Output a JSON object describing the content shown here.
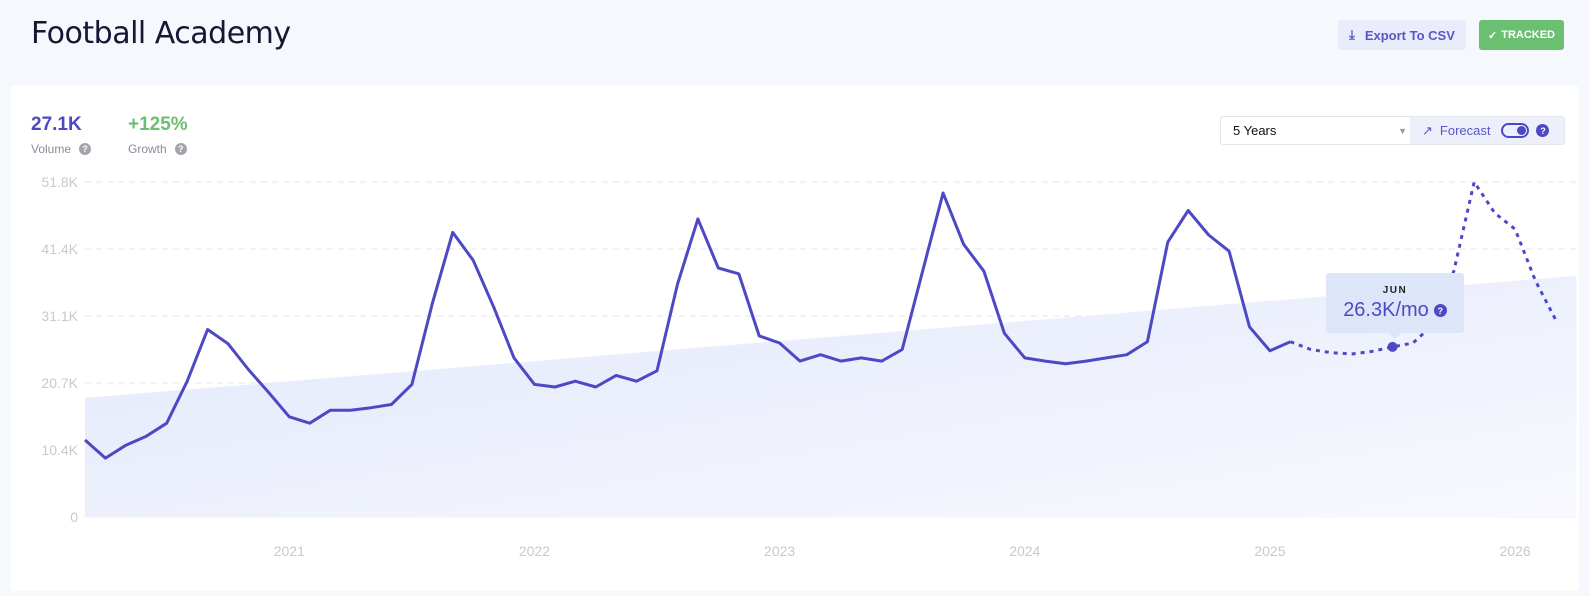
{
  "header": {
    "title": "Football Academy",
    "export_label": "Export To CSV",
    "tracked_label": "TRACKED",
    "check_glyph": "✓",
    "download_glyph": "⤓"
  },
  "stats": {
    "volume_value": "27.1K",
    "volume_label": "Volume",
    "growth_value": "+125%",
    "growth_label": "Growth",
    "help_glyph": "?"
  },
  "controls": {
    "range_selected": "5 Years",
    "caret_glyph": "▼",
    "forecast_label": "Forecast",
    "forecast_enabled": true,
    "trend_glyph": "↗"
  },
  "tooltip": {
    "month": "JUN",
    "value": "26.3K/mo"
  },
  "colors": {
    "accent": "#4d49c5",
    "growth": "#6bbf71",
    "trend_fill": "#e4e9fb"
  },
  "chart_data": {
    "type": "line",
    "title": "",
    "xlabel": "",
    "ylabel": "Volume",
    "ylim": [
      0,
      51800
    ],
    "y_ticks": [
      "0",
      "10.4K",
      "20.7K",
      "31.1K",
      "41.4K",
      "51.8K"
    ],
    "y_tick_values": [
      0,
      10360,
      20720,
      31080,
      41440,
      51800
    ],
    "x_ticks": [
      "2021",
      "2022",
      "2023",
      "2024",
      "2025",
      "2026"
    ],
    "x_tick_months": [
      10,
      22,
      34,
      46,
      58,
      70
    ],
    "grid": true,
    "series": [
      {
        "name": "Volume",
        "style": "solid",
        "start_month_index": 0,
        "values": [
          11900,
          9100,
          11100,
          12500,
          14500,
          21000,
          29000,
          26800,
          22800,
          19200,
          15500,
          14500,
          16500,
          16500,
          16900,
          17400,
          20500,
          33000,
          44000,
          39700,
          32500,
          24600,
          20500,
          20100,
          21000,
          20100,
          21900,
          21000,
          22600,
          36000,
          46100,
          38500,
          37600,
          28000,
          26900,
          24100,
          25100,
          24100,
          24600,
          24100,
          25900,
          38000,
          50100,
          42200,
          38000,
          28400,
          24600,
          24100,
          23700,
          24100,
          24600,
          25100,
          27100,
          42500,
          47400,
          43600,
          41100,
          29400,
          25700,
          27100
        ]
      },
      {
        "name": "Forecast",
        "style": "dashed",
        "start_month_index": 59,
        "values": [
          27100,
          25900,
          25400,
          25200,
          25600,
          26300,
          26900,
          29800,
          38000,
          51800,
          47000,
          44500,
          36500,
          30400
        ]
      },
      {
        "name": "Trend",
        "style": "area",
        "start_month_index": 0,
        "values": [
          18400,
          37300
        ]
      }
    ],
    "highlight": {
      "series": "Forecast",
      "month": "JUN",
      "value": 26300
    }
  }
}
